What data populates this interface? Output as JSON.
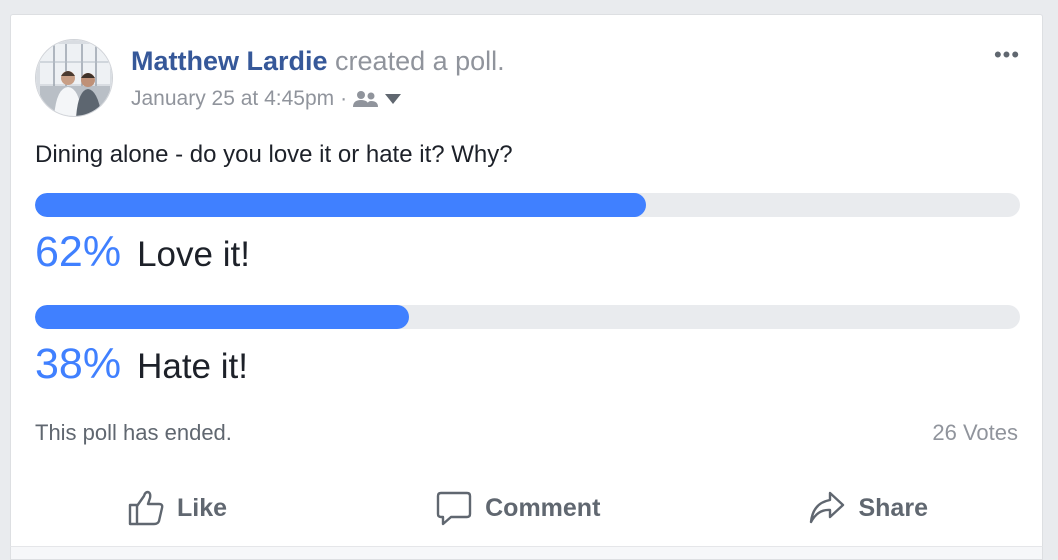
{
  "post": {
    "author_name": "Matthew Lardie",
    "action_text": "created a poll.",
    "timestamp": "January 25 at 4:45pm",
    "separator": "·",
    "audience_icon": "friends-icon",
    "audience_dropdown_icon": "caret-down-icon",
    "more_icon": "more-options-icon",
    "more_label": "•••"
  },
  "poll": {
    "question": "Dining alone - do you love it or hate it? Why?",
    "options": [
      {
        "percent_label": "62%",
        "label": "Love it!",
        "fraction": 0.62
      },
      {
        "percent_label": "38%",
        "label": "Hate it!",
        "fraction": 0.38
      }
    ],
    "status": "This poll has ended.",
    "votes": "26 Votes"
  },
  "actions": {
    "like_label": "Like",
    "comment_label": "Comment",
    "share_label": "Share",
    "like_icon": "thumbs-up-icon",
    "comment_icon": "speech-bubble-icon",
    "share_icon": "share-arrow-icon"
  },
  "colors": {
    "accent": "#4080ff",
    "author_link": "#365899",
    "muted_text": "#90949c",
    "track": "#e9ebee"
  }
}
